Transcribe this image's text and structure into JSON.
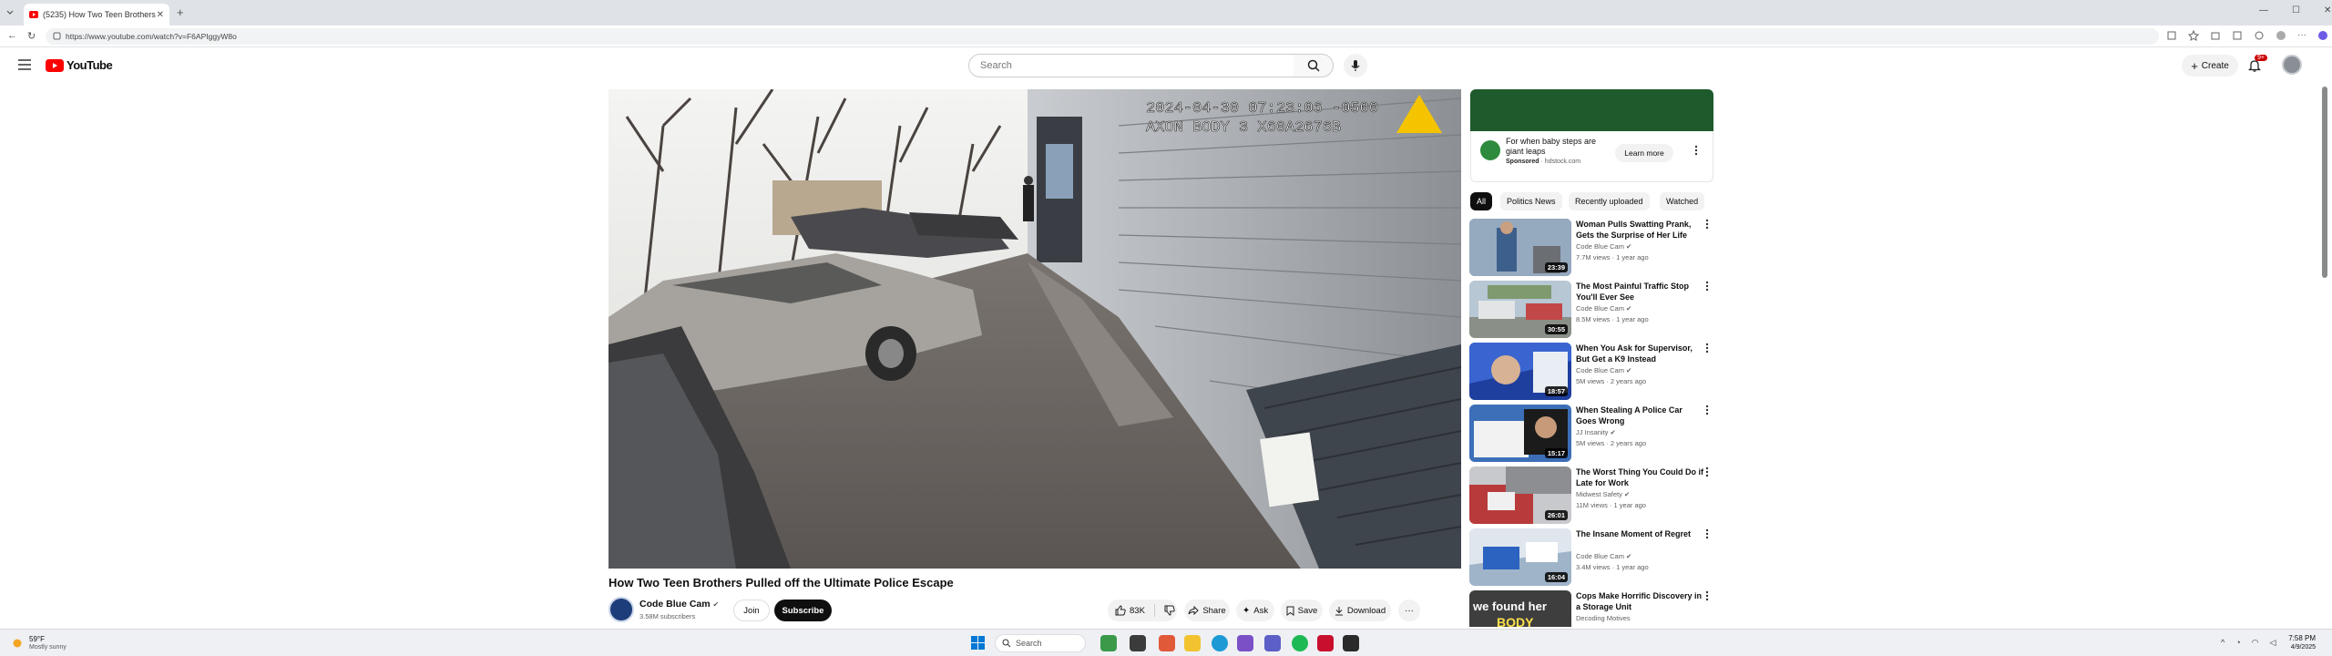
{
  "browser": {
    "tab_title": "(5235) How Two Teen Brothers Pulled off the Ultimate Police Escape - YouTube",
    "url": "https://www.youtube.com/watch?v=F6APIggyW8o"
  },
  "header": {
    "logo_text": "YouTube",
    "search_placeholder": "Search",
    "create_label": "Create",
    "notifications_badge": "9+"
  },
  "video": {
    "timestamp_overlay": "2024-04-30 07:23:06 -0500",
    "device_overlay": "AXON BODY 3 X60A2676B",
    "title": "How Two Teen Brothers Pulled off the Ultimate Police Escape",
    "channel_name": "Code Blue Cam",
    "subscribers": "3.58M subscribers",
    "join_label": "Join",
    "subscribe_label": "Subscribe",
    "likes": "83K",
    "share_label": "Share",
    "ask_label": "Ask",
    "save_label": "Save",
    "download_label": "Download"
  },
  "ad": {
    "title": "For when baby steps are giant leaps",
    "sponsored": "Sponsored",
    "domain": "hdstock.com",
    "cta": "Learn more"
  },
  "chips": [
    "All",
    "Politics News",
    "Recently uploaded",
    "Watched"
  ],
  "recommendations": [
    {
      "title": "Woman Pulls Swatting Prank, Gets the Surprise of Her Life",
      "channel": "Code Blue Cam",
      "meta": "7.7M views · 1 year ago",
      "duration": "23:39",
      "thumb_color": "#6d8bb0"
    },
    {
      "title": "The Most Painful Traffic Stop You'll Ever See",
      "channel": "Code Blue Cam",
      "meta": "8.5M views · 1 year ago",
      "duration": "30:55",
      "thumb_color": "#7fa0b8"
    },
    {
      "title": "When You Ask for Supervisor, But Get a K9 Instead",
      "channel": "Code Blue Cam",
      "meta": "5M views · 2 years ago",
      "duration": "18:57",
      "thumb_color": "#2b4fb0"
    },
    {
      "title": "When Stealing A Police Car Goes Wrong",
      "channel": "JJ Insanity",
      "meta": "5M views · 2 years ago",
      "duration": "15:17",
      "thumb_color": "#3d6fb8"
    },
    {
      "title": "The Worst Thing You Could Do if Late for Work",
      "channel": "Midwest Safety",
      "meta": "11M views · 1 year ago",
      "duration": "26:01",
      "thumb_color": "#b83a3a"
    },
    {
      "title": "The Insane Moment of Regret",
      "channel": "Code Blue Cam",
      "meta": "3.4M views · 1 year ago",
      "duration": "16:04",
      "thumb_color": "#8fa8c8"
    },
    {
      "title": "Cops Make Horrific Discovery in a Storage Unit",
      "channel": "Decoding Motives",
      "meta": "",
      "duration": "",
      "thumb_color": "#4a4a4a"
    }
  ],
  "taskbar": {
    "weather_temp": "59°F",
    "weather_desc": "Mostly sunny",
    "search_label": "Search",
    "time": "7:58 PM",
    "date": "4/9/2025"
  }
}
